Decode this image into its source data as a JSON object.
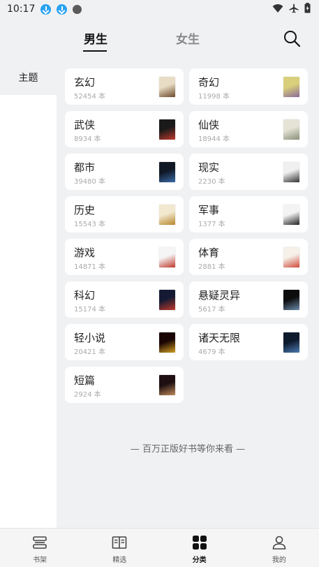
{
  "status_bar": {
    "time": "10:17"
  },
  "header": {
    "tabs": [
      {
        "label": "男生",
        "active": true
      },
      {
        "label": "女生",
        "active": false
      }
    ]
  },
  "sidebar": {
    "items": [
      {
        "label": "主题",
        "active": true
      }
    ]
  },
  "categories": [
    {
      "name": "玄幻",
      "count": "52454 本",
      "cover_colors": [
        "#e8dcc4",
        "#6b4a2a"
      ]
    },
    {
      "name": "奇幻",
      "count": "11998 本",
      "cover_colors": [
        "#d9cf7a",
        "#8a6a9a"
      ]
    },
    {
      "name": "武侠",
      "count": "8934 本",
      "cover_colors": [
        "#1a1a1a",
        "#c0392b"
      ]
    },
    {
      "name": "仙侠",
      "count": "18944 本",
      "cover_colors": [
        "#e5e3d6",
        "#8a8f7a"
      ]
    },
    {
      "name": "都市",
      "count": "39480 本",
      "cover_colors": [
        "#101826",
        "#3a6aa8"
      ]
    },
    {
      "name": "现实",
      "count": "2230 本",
      "cover_colors": [
        "#f0f0f0",
        "#333333"
      ]
    },
    {
      "name": "历史",
      "count": "15543 本",
      "cover_colors": [
        "#f2e8d0",
        "#b8862a"
      ]
    },
    {
      "name": "军事",
      "count": "1377 本",
      "cover_colors": [
        "#f3f3f3",
        "#222222"
      ]
    },
    {
      "name": "游戏",
      "count": "14871 本",
      "cover_colors": [
        "#f5f5f5",
        "#c0392b"
      ]
    },
    {
      "name": "体育",
      "count": "2881 本",
      "cover_colors": [
        "#f5f0e8",
        "#d04a3a"
      ]
    },
    {
      "name": "科幻",
      "count": "15174 本",
      "cover_colors": [
        "#141a33",
        "#c0392b"
      ]
    },
    {
      "name": "悬疑灵异",
      "count": "5617 本",
      "cover_colors": [
        "#0d0d0d",
        "#6a8aaa"
      ]
    },
    {
      "name": "轻小说",
      "count": "20421 本",
      "cover_colors": [
        "#1a0505",
        "#d4a020"
      ]
    },
    {
      "name": "诸天无限",
      "count": "4679 本",
      "cover_colors": [
        "#0e1a2e",
        "#4a7ab0"
      ]
    },
    {
      "name": "短篇",
      "count": "2924 本",
      "cover_colors": [
        "#1e1012",
        "#c08a5a"
      ]
    }
  ],
  "slogan": "— 百万正版好书等你来看 —",
  "bottom_nav": {
    "items": [
      {
        "label": "书架",
        "icon": "bookshelf-icon",
        "active": false
      },
      {
        "label": "精选",
        "icon": "open-book-icon",
        "active": false
      },
      {
        "label": "分类",
        "icon": "category-grid-icon",
        "active": true
      },
      {
        "label": "我的",
        "icon": "profile-icon",
        "active": false
      }
    ]
  },
  "colors": {
    "background": "#f0f1f3",
    "card": "#ffffff",
    "download_badge": "#27a2f2",
    "active_text": "#111111",
    "inactive_text": "#888888"
  }
}
